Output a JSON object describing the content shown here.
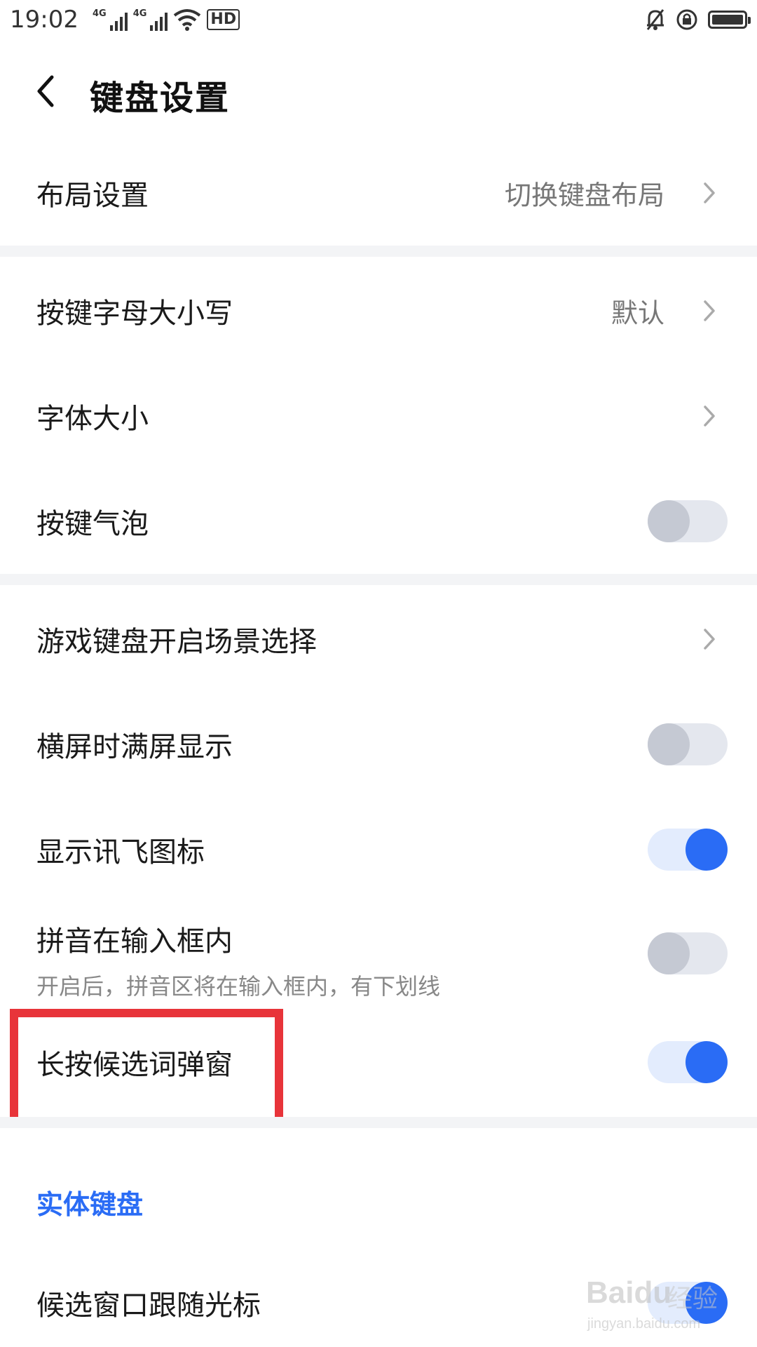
{
  "status_bar": {
    "time": "19:02",
    "network_1": "4G",
    "network_2": "4G",
    "hd_label": "HD",
    "icons": [
      "signal-icon",
      "signal-icon",
      "wifi-icon",
      "hd-icon",
      "mute-icon",
      "rotation-lock-icon",
      "battery-icon"
    ]
  },
  "header": {
    "back_icon": "chevron-left-icon",
    "title": "键盘设置"
  },
  "settings": {
    "layout": {
      "label": "布局设置",
      "value": "切换键盘布局"
    },
    "key_case": {
      "label": "按键字母大小写",
      "value": "默认"
    },
    "font_size": {
      "label": "字体大小"
    },
    "key_bubble": {
      "label": "按键气泡",
      "enabled": false
    },
    "game_keyboard": {
      "label": "游戏键盘开启场景选择"
    },
    "landscape_fullscreen": {
      "label": "横屏时满屏显示",
      "enabled": false
    },
    "show_icon": {
      "label": "显示讯飞图标",
      "enabled": true
    },
    "pinyin_inline": {
      "label": "拼音在输入框内",
      "description": "开启后，拼音区将在输入框内，有下划线",
      "enabled": false
    },
    "long_press_popup": {
      "label": "长按候选词弹窗",
      "enabled": true
    }
  },
  "physical_keyboard": {
    "section_title": "实体键盘",
    "follow_cursor": {
      "label": "候选窗口跟随光标",
      "enabled": true
    }
  },
  "watermark": {
    "brand": "Baidu",
    "brand_cn": "经验",
    "url": "jingyan.baidu.com"
  },
  "colors": {
    "accent": "#2a6cf5",
    "highlight": "#e8343a",
    "divider": "#f3f4f6"
  }
}
